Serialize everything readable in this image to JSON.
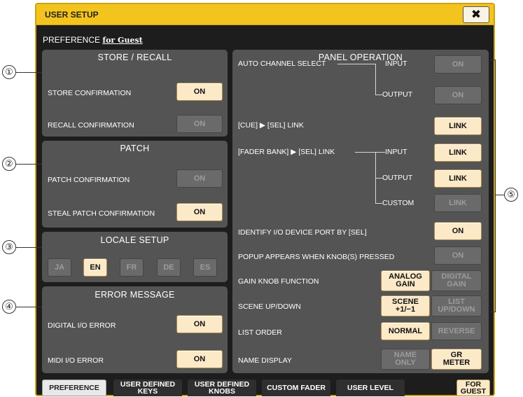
{
  "window": {
    "title": "USER SETUP",
    "close_label": "✖"
  },
  "preference": {
    "label": "PREFERENCE",
    "for_label": "for Guest"
  },
  "store_recall": {
    "title": "STORE / RECALL",
    "store_label": "STORE CONFIRMATION",
    "store_value": "ON",
    "recall_label": "RECALL CONFIRMATION",
    "recall_value": "ON"
  },
  "patch": {
    "title": "PATCH",
    "patch_label": "PATCH CONFIRMATION",
    "patch_value": "ON",
    "steal_label": "STEAL PATCH CONFIRMATION",
    "steal_value": "ON"
  },
  "locale": {
    "title": "LOCALE SETUP",
    "languages": [
      "JA",
      "EN",
      "FR",
      "DE",
      "ES"
    ],
    "selected": "EN"
  },
  "error": {
    "title": "ERROR MESSAGE",
    "digital_label": "DIGITAL I/O ERROR",
    "digital_value": "ON",
    "midi_label": "MIDI I/O ERROR",
    "midi_value": "ON"
  },
  "panel_operation": {
    "title": "PANEL OPERATION",
    "auto_channel_label": "AUTO CHANNEL SELECT",
    "input_label": "INPUT",
    "output_label": "OUTPUT",
    "custom_label": "CUSTOM",
    "auto_input_value": "ON",
    "auto_output_value": "ON",
    "cue_label": "[CUE] ▶ [SEL] LINK",
    "cue_value": "LINK",
    "fader_label": "[FADER BANK] ▶ [SEL] LINK",
    "fader_input_value": "LINK",
    "fader_output_value": "LINK",
    "fader_custom_value": "LINK",
    "identify_label": "IDENTIFY I/O DEVICE PORT BY [SEL]",
    "identify_value": "ON",
    "popup_label": "POPUP APPEARS WHEN KNOB(S) PRESSED",
    "popup_value": "ON",
    "gain_label": "GAIN KNOB FUNCTION",
    "gain_analog_1": "ANALOG",
    "gain_analog_2": "GAIN",
    "gain_digital_1": "DIGITAL",
    "gain_digital_2": "GAIN",
    "scene_label": "SCENE UP/DOWN",
    "scene_1": "SCENE",
    "scene_2": "+1/−1",
    "list_btn_1": "LIST",
    "list_btn_2": "UP/DOWN",
    "list_order_label": "LIST ORDER",
    "normal": "NORMAL",
    "reverse": "REVERSE",
    "name_display_label": "NAME DISPLAY",
    "name_only_1": "NAME",
    "name_only_2": "ONLY",
    "gr_meter_1": "GR",
    "gr_meter_2": "METER"
  },
  "tabs": {
    "preference": "PREFERENCE",
    "keys_1": "USER DEFINED",
    "keys_2": "KEYS",
    "knobs_1": "USER DEFINED",
    "knobs_2": "KNOBS",
    "custom_fader": "CUSTOM FADER",
    "user_level": "USER LEVEL",
    "guest_1": "FOR",
    "guest_2": "GUEST"
  },
  "callouts": [
    "①",
    "②",
    "③",
    "④",
    "⑤"
  ],
  "colors": {
    "accent": "#f4c41e",
    "on_button": "#fbe9c8",
    "panel": "#545454",
    "background": "#1d1d1d"
  }
}
